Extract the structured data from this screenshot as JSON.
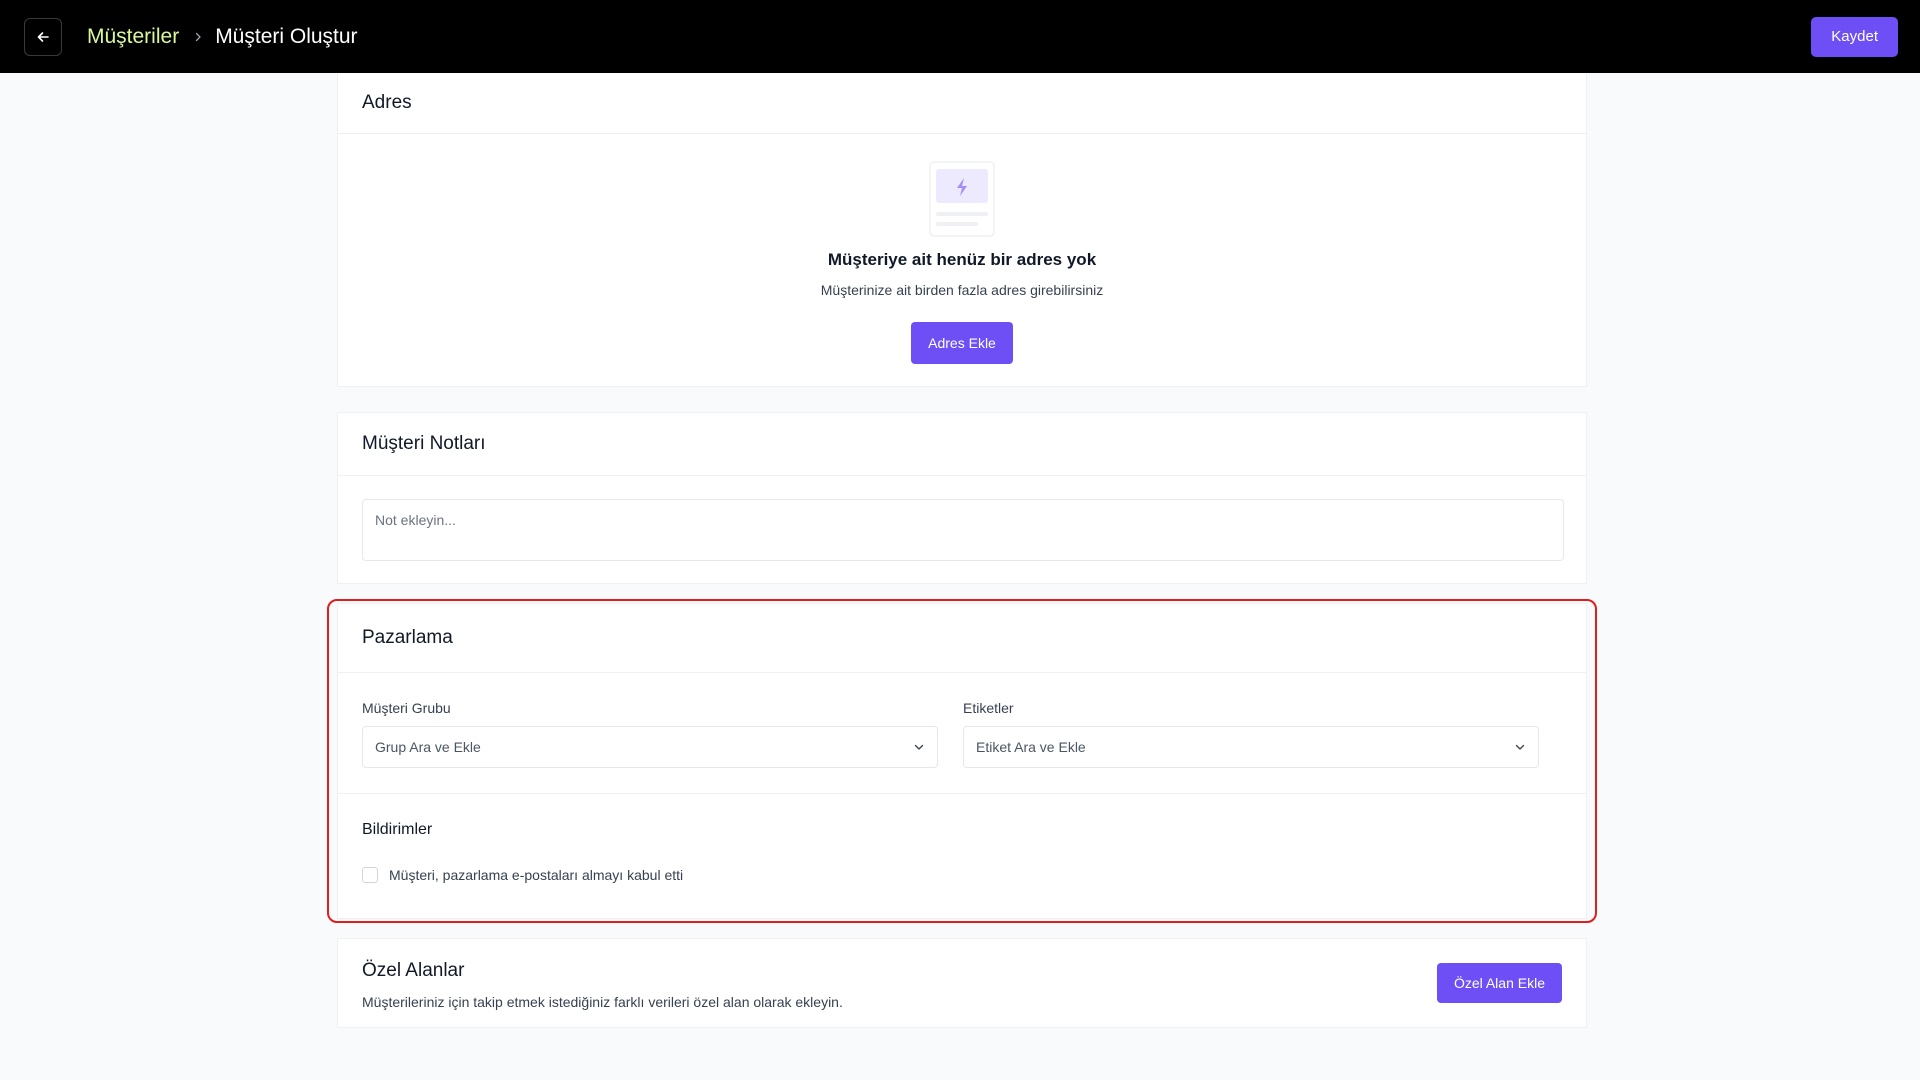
{
  "header": {
    "breadcrumb_parent": "Müşteriler",
    "breadcrumb_current": "Müşteri Oluştur",
    "save_label": "Kaydet"
  },
  "address": {
    "title": "Adres",
    "empty_title": "Müşteriye ait henüz bir adres yok",
    "empty_subtitle": "Müşterinize ait birden fazla adres girebilirsiniz",
    "add_label": "Adres Ekle"
  },
  "notes": {
    "title": "Müşteri Notları",
    "placeholder": "Not ekleyin..."
  },
  "marketing": {
    "title": "Pazarlama",
    "group_label": "Müşteri Grubu",
    "group_placeholder": "Grup Ara ve Ekle",
    "tags_label": "Etiketler",
    "tags_placeholder": "Etiket Ara ve Ekle",
    "notifications_title": "Bildirimler",
    "consent_label": "Müşteri, pazarlama e-postaları almayı kabul etti",
    "consent_checked": false
  },
  "custom_fields": {
    "title": "Özel Alanlar",
    "description": "Müşterileriniz için takip etmek istediğiniz farklı verileri özel alan olarak ekleyin.",
    "add_label": "Özel Alan Ekle"
  },
  "colors": {
    "topbar_bg": "#000000",
    "breadcrumb_link": "#d9f99d",
    "primary": "#6e4ff5",
    "highlight": "#e11d1d"
  },
  "icons": {
    "back": "arrow-left-icon",
    "separator": "chevron-right-icon",
    "select": "chevron-down-icon",
    "empty_state": "document-lightning-icon"
  }
}
